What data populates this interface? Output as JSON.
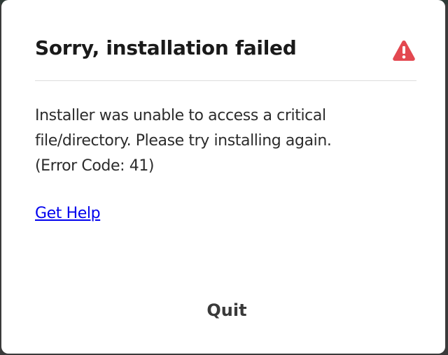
{
  "dialog": {
    "title": "Sorry, installation failed",
    "icon": "warning-triangle-icon",
    "accent_color": "#e34850",
    "message_lines": [
      "Installer was unable to access a critical",
      "file/directory. Please try installing again.",
      "(Error Code: 41)"
    ],
    "help_link_label": "Get Help",
    "quit_label": "Quit"
  }
}
